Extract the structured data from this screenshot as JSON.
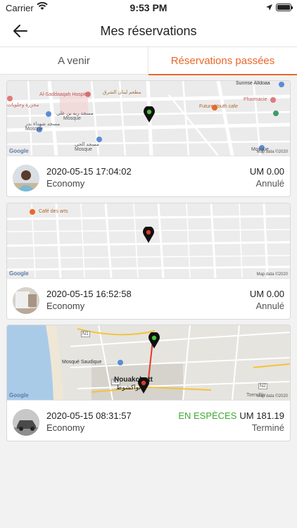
{
  "status_bar": {
    "carrier": "Carrier",
    "time": "9:53 PM"
  },
  "header": {
    "title": "Mes réservations"
  },
  "tabs": [
    {
      "label": "A venir",
      "active": false
    },
    {
      "label": "Réservations passées",
      "active": true
    }
  ],
  "colors": {
    "accent": "#e8672a",
    "cash_green": "#3ea832"
  },
  "trips": [
    {
      "datetime": "2020-05-15 17:04:02",
      "vehicle": "Economy",
      "price": "UM 0.00",
      "payment": "",
      "status": "Annulé",
      "map": {
        "google": "Google",
        "data": "Map data ©2020",
        "labels": [
          "Al-Saddaaqah Hospital",
          "مطعم لبنان الشرق",
          "Sunrise Alldoaa",
          "Pharmacie",
          "Future Youth cafe",
          "مجزرة وحلويات",
          "مسجد ربه بن علي",
          "Mosque",
          "مسجد شهداء بدر",
          "Mosque",
          "مسجد الحي",
          "Mosque",
          "Mosque"
        ]
      }
    },
    {
      "datetime": "2020-05-15 16:52:58",
      "vehicle": "Economy",
      "price": "UM 0.00",
      "payment": "",
      "status": "Annulé",
      "map": {
        "google": "Google",
        "data": "Map data ©2020",
        "labels": [
          "Café des arts"
        ]
      }
    },
    {
      "datetime": "2020-05-15 08:31:57",
      "vehicle": "Economy",
      "price": "UM 181.19",
      "payment": "EN ESPÈCES",
      "status": "Terminé",
      "map": {
        "google": "Google",
        "data": "Map data ©2020",
        "labels": [
          "Mosqué Saudique",
          "Nouakchott",
          "نواكشوط",
          "N1",
          "N3",
          "N2",
          "Toen Riv"
        ]
      }
    }
  ]
}
